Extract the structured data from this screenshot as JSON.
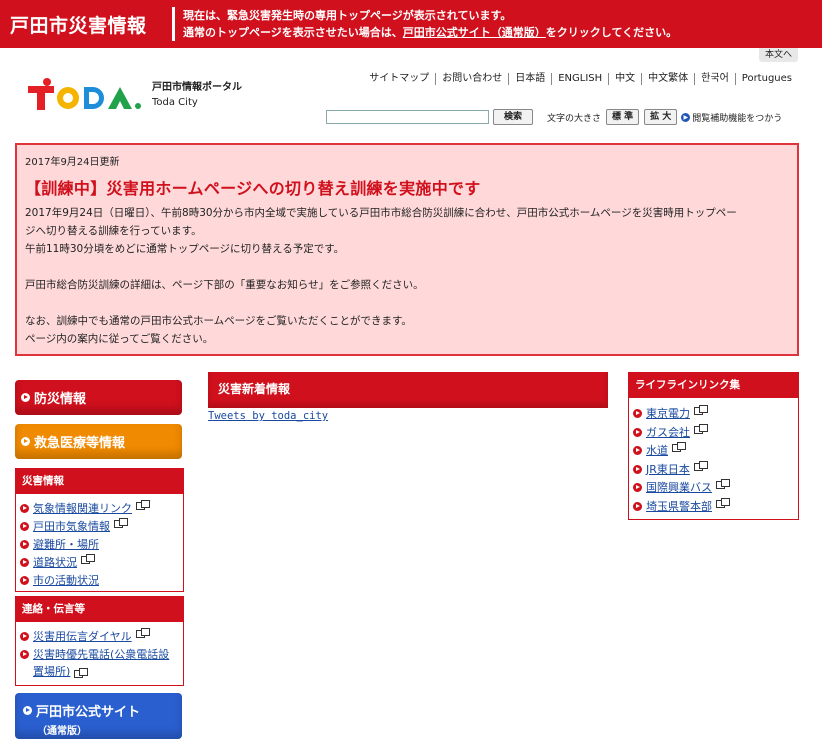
{
  "banner": {
    "site_title": "戸田市災害情報",
    "message_line1": "現在は、緊急災害発生時の専用トップページが表示されています。",
    "message_line2_pre": "通常のトップページを表示させたい場合は、",
    "message_line2_link": "戸田市公式サイト（通常版）",
    "message_line2_post": "をクリックしてください。"
  },
  "skip_link": "本文へ",
  "logo": {
    "brand": "TODA",
    "portal_name": "戸田市情報ポータル",
    "city_name": "Toda City"
  },
  "utility_nav": [
    "サイトマップ",
    "お問い合わせ",
    "日本語",
    "ENGLISH",
    "中文",
    "中文繁体",
    "한국어",
    "Portugues"
  ],
  "search": {
    "placeholder": "",
    "button_label": "検索"
  },
  "font_size": {
    "label": "文字の大きさ",
    "standard": "標 準",
    "large": "拡 大"
  },
  "accessibility_label": "閲覧補助機能をつかう",
  "alert": {
    "updated": "2017年9月24日更新",
    "title": "【訓練中】災害用ホームページへの切り替え訓練を実施中です",
    "p1": "2017年9月24日（日曜日）、午前8時30分から市内全域で実施している戸田市市総合防災訓練に合わせ、戸田市公式ホームページを災害時用トップペー",
    "p2": "ジへ切り替える訓練を行っています。",
    "p3": "午前11時30分頃をめどに通常トップページに切り替える予定です。",
    "p4": "戸田市総合防災訓練の詳細は、ページ下部の「重要なお知らせ」をご参照ください。",
    "p5": "なお、訓練中でも通常の戸田市公式ホームページをご覧いただくことができます。",
    "p6": "ページ内の案内に従ってご覧ください。"
  },
  "left": {
    "btn_bousai": "防災情報",
    "btn_kyukyu": "救急医療等情報",
    "saigai": {
      "heading": "災害情報",
      "items": [
        "気象情報関連リンク",
        "戸田市気象情報",
        "避難所・場所",
        "道路状況",
        "市の活動状況"
      ]
    },
    "renraku": {
      "heading": "連絡・伝言等",
      "item1": "災害用伝言ダイヤル",
      "item2_line1": "災害時優先電話(公衆電話設",
      "item2_line2": "置場所)"
    },
    "btn_official_line1": "戸田市公式サイト",
    "btn_official_line2": "（通常版）"
  },
  "center": {
    "heading": "災害新着情報",
    "tweets_link": "Tweets by toda_city"
  },
  "lifeline": {
    "heading": "ライフラインリンク集",
    "items": [
      "東京電力",
      "ガス会社",
      "水道",
      "JR東日本",
      "国際興業バス",
      "埼玉県警本部"
    ]
  }
}
